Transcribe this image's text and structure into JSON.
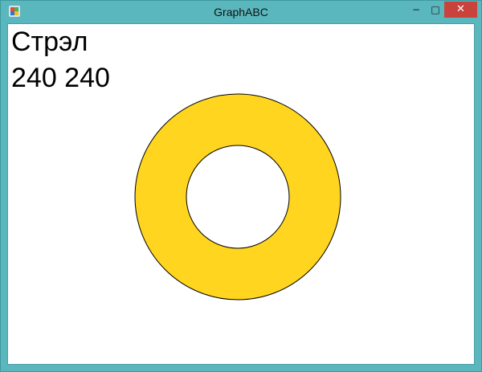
{
  "window": {
    "title": "GraphABC",
    "controls": {
      "minimize": "−",
      "maximize": "□",
      "close": "✕"
    },
    "icon": "app-icon"
  },
  "canvas": {
    "text_lines": [
      "Стрэл",
      "240 240"
    ],
    "ring": {
      "fill_color": "#FFD520",
      "stroke_color": "#000000",
      "hole_color": "#FFFFFF"
    }
  }
}
